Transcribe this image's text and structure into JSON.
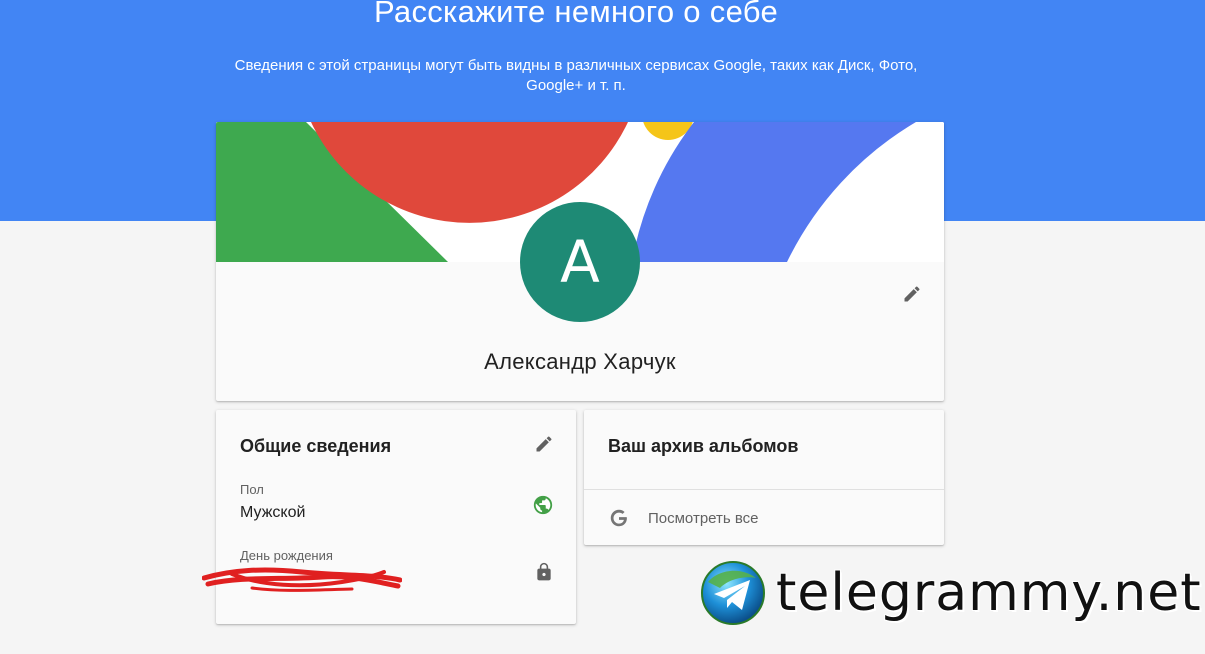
{
  "header": {
    "title": "Расскажите немного о себе",
    "subtitle": "Сведения с этой страницы могут быть видны в различных сервисах Google, таких как Диск, Фото, Google+ и т. п."
  },
  "profile": {
    "avatar_letter": "A",
    "name": "Александр Харчук",
    "edit_icon": "pencil-icon"
  },
  "general_info": {
    "title": "Общие сведения",
    "fields": [
      {
        "label": "Пол",
        "value": "Мужской",
        "visibility_icon": "globe-icon"
      },
      {
        "label": "День рождения",
        "value": "",
        "visibility_icon": "lock-icon"
      }
    ]
  },
  "albums": {
    "title": "Ваш архив альбомов",
    "link_label": "Посмотреть все",
    "link_icon": "google-g-icon"
  },
  "watermark": {
    "text": "telegrammy.net"
  },
  "colors": {
    "header_blue": "#4285f4",
    "avatar_green": "#1e8a75",
    "banner_red": "#e0483b",
    "banner_green": "#3ea94f",
    "banner_blue": "#5578f0",
    "banner_yellow": "#f5c518",
    "globe_green": "#43a047"
  }
}
